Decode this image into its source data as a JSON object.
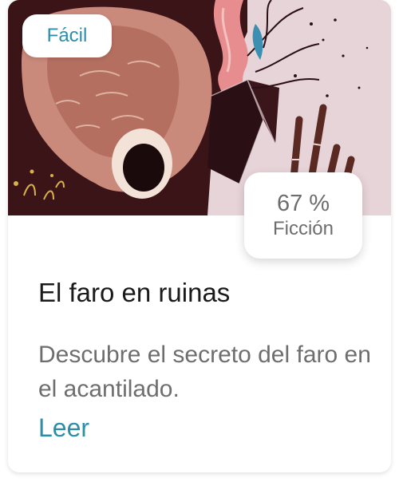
{
  "card": {
    "level": "Fácil",
    "stat_percent": "67 %",
    "stat_genre": "Ficción",
    "title": "El faro en ruinas",
    "description": "Descubre el secreto del faro en el acantilado.",
    "read_label": "Leer"
  },
  "colors": {
    "accent": "#2b8fa8",
    "title": "#1a1a1a",
    "muted": "#6e6e6e"
  }
}
